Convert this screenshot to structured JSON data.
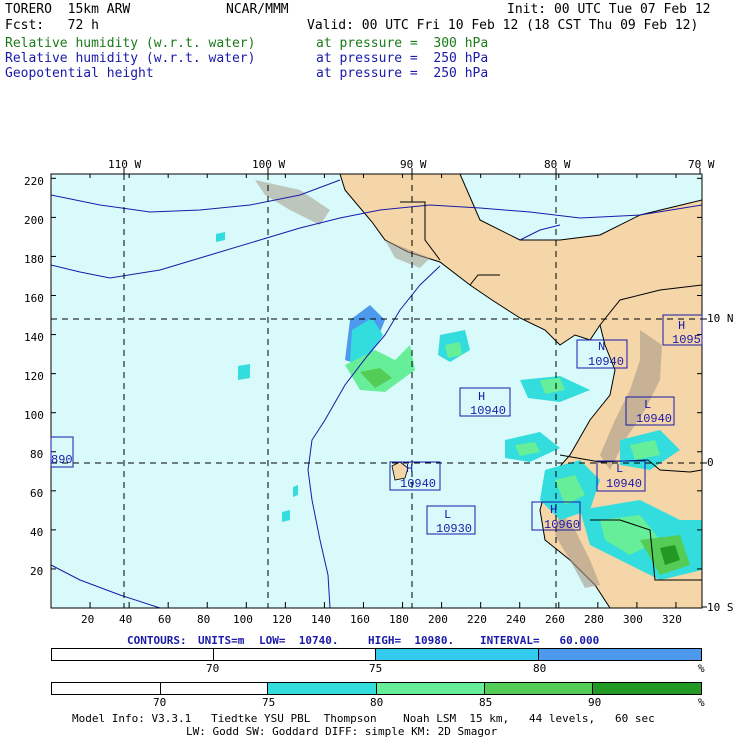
{
  "header": {
    "model": "TORERO  15km ARW",
    "center": "NCAR/MMM",
    "init": "Init: 00 UTC Tue 07 Feb 12",
    "fcst": "Fcst:   72 h",
    "valid": "Valid: 00 UTC Fri 10 Feb 12 (18 CST Thu 09 Feb 12)"
  },
  "fields": [
    {
      "name": "Relative humidity (w.r.t. water)",
      "level": "at pressure =  300 hPa",
      "color": "#1a7a1a"
    },
    {
      "name": "Relative humidity (w.r.t. water)",
      "level": "at pressure =  250 hPa",
      "color": "#1a1aaa"
    },
    {
      "name": "Geopotential height",
      "level": "at pressure =  250 hPa",
      "color": "#1a1aaa"
    }
  ],
  "top_lon_labels": [
    "110 W",
    "100 W",
    "90 W",
    "80 W",
    "70 W"
  ],
  "right_lat_labels": [
    "10 N",
    "0",
    "10 S"
  ],
  "y_ticks": [
    "220",
    "200",
    "180",
    "160",
    "140",
    "120",
    "100",
    "80",
    "60",
    "40",
    "20"
  ],
  "x_ticks": [
    "20",
    "40",
    "60",
    "80",
    "100",
    "120",
    "140",
    "160",
    "180",
    "200",
    "220",
    "240",
    "260",
    "280",
    "300",
    "320"
  ],
  "height_boxes": [
    {
      "letter": "N",
      "value": "10940"
    },
    {
      "letter": "H",
      "value": "1095"
    },
    {
      "letter": "H",
      "value": "10940"
    },
    {
      "letter": "L",
      "value": "10940"
    },
    {
      "letter": "",
      "value": "890"
    },
    {
      "letter": "H",
      "value": "10940"
    },
    {
      "letter": "L",
      "value": "10940"
    },
    {
      "letter": "L",
      "value": "10930"
    },
    {
      "letter": "H",
      "value": "10960"
    }
  ],
  "contours": {
    "label": "CONTOURS:",
    "units": "UNITS=m",
    "low": "LOW=  10740.",
    "high": "HIGH=  10980.",
    "interval": "INTERVAL=   60.000"
  },
  "colorbar1": {
    "labels": [
      "70",
      "75",
      "80",
      "%"
    ],
    "colors": [
      "#ffffff",
      "#ffffff",
      "#33ccee",
      "#4d99ee"
    ]
  },
  "colorbar2": {
    "labels": [
      "70",
      "75",
      "80",
      "85",
      "90",
      "%"
    ],
    "colors": [
      "#ffffff",
      "#ffffff",
      "#33dddd",
      "#66ee99",
      "#55cc55",
      "#229922"
    ]
  },
  "footer": {
    "line1": "Model Info: V3.3.1   Tiedtke YSU PBL  Thompson    Noah LSM  15 km,   44 levels,   60 sec",
    "line2": "LW: Godd SW: Goddard DIFF: simple KM: 2D Smagor"
  }
}
